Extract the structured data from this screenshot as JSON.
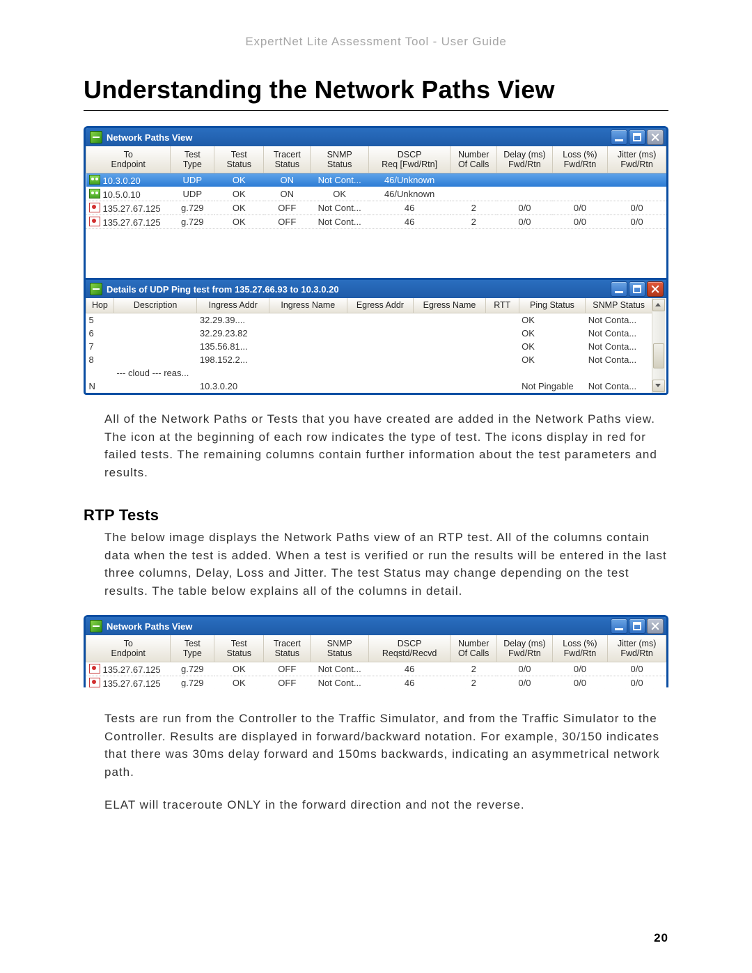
{
  "header": "ExpertNet Lite Assessment Tool - User Guide",
  "title": "Understanding the Network Paths View",
  "page_number": "20",
  "window1": {
    "title": "Network Paths View",
    "columns": {
      "endpoint": "To\nEndpoint",
      "type": "Test\nType",
      "status": "Test\nStatus",
      "tracert": "Tracert\nStatus",
      "snmp": "SNMP\nStatus",
      "dscp": "DSCP\nReq [Fwd/Rtn]",
      "ncalls": "Number\nOf Calls",
      "delay": "Delay (ms)\nFwd/Rtn",
      "loss": "Loss (%)\nFwd/Rtn",
      "jitter": "Jitter (ms)\nFwd/Rtn"
    },
    "rows": [
      {
        "icon": "green",
        "selected": true,
        "endpoint": "10.3.0.20",
        "type": "UDP",
        "status": "OK",
        "tracert": "ON",
        "snmp": "Not Cont...",
        "dscp": "46/Unknown",
        "ncalls": "",
        "delay": "",
        "loss": "",
        "jitter": ""
      },
      {
        "icon": "green",
        "selected": false,
        "endpoint": "10.5.0.10",
        "type": "UDP",
        "status": "OK",
        "tracert": "ON",
        "snmp": "OK",
        "dscp": "46/Unknown",
        "ncalls": "",
        "delay": "",
        "loss": "",
        "jitter": ""
      },
      {
        "icon": "red",
        "selected": false,
        "endpoint": "135.27.67.125",
        "type": "g.729",
        "status": "OK",
        "tracert": "OFF",
        "snmp": "Not Cont...",
        "dscp": "46",
        "ncalls": "2",
        "delay": "0/0",
        "loss": "0/0",
        "jitter": "0/0"
      },
      {
        "icon": "red",
        "selected": false,
        "endpoint": "135.27.67.125",
        "type": "g.729",
        "status": "OK",
        "tracert": "OFF",
        "snmp": "Not Cont...",
        "dscp": "46",
        "ncalls": "2",
        "delay": "0/0",
        "loss": "0/0",
        "jitter": "0/0"
      }
    ]
  },
  "window2": {
    "title": "Details of UDP Ping test from 135.27.66.93 to 10.3.0.20",
    "columns": {
      "hop": "Hop",
      "desc": "Description",
      "inaddr": "Ingress Addr",
      "inname": "Ingress Name",
      "eaddr": "Egress Addr",
      "ename": "Egress Name",
      "rtt": "RTT",
      "ping": "Ping Status",
      "snmp": "SNMP Status"
    },
    "rows": [
      {
        "hop": "5",
        "desc": "",
        "inaddr": "32.29.39....",
        "inname": "",
        "eaddr": "",
        "ename": "",
        "rtt": "",
        "ping": "OK",
        "snmp": "Not Conta..."
      },
      {
        "hop": "6",
        "desc": "",
        "inaddr": "32.29.23.82",
        "inname": "",
        "eaddr": "",
        "ename": "",
        "rtt": "",
        "ping": "OK",
        "snmp": "Not Conta..."
      },
      {
        "hop": "7",
        "desc": "",
        "inaddr": "135.56.81...",
        "inname": "",
        "eaddr": "",
        "ename": "",
        "rtt": "",
        "ping": "OK",
        "snmp": "Not Conta..."
      },
      {
        "hop": "8",
        "desc": "",
        "inaddr": "198.152.2...",
        "inname": "",
        "eaddr": "",
        "ename": "",
        "rtt": "",
        "ping": "OK",
        "snmp": "Not Conta..."
      },
      {
        "hop": "",
        "desc": "--- cloud --- reas...",
        "inaddr": "",
        "inname": "",
        "eaddr": "",
        "ename": "",
        "rtt": "",
        "ping": "",
        "snmp": ""
      },
      {
        "hop": "N",
        "desc": "",
        "inaddr": "10.3.0.20",
        "inname": "",
        "eaddr": "",
        "ename": "",
        "rtt": "",
        "ping": "Not Pingable",
        "snmp": "Not Conta..."
      }
    ]
  },
  "paragraph1": "All of the Network Paths or Tests that you have created are added in the Network Paths view. The icon at the beginning of each row indicates the type of test. The icons display in red for failed tests. The remaining columns contain further information about the test parameters and results.",
  "section1_title": "RTP Tests",
  "paragraph2": "The below image displays the Network Paths view of an RTP test. All of the columns contain data when the test is added. When a test is verified or run the results will be entered in the last three columns, Delay, Loss and Jitter. The test Status may change depending on the test results. The table below explains all of the columns in detail.",
  "window3": {
    "title": "Network Paths View",
    "columns": {
      "endpoint": "To\nEndpoint",
      "type": "Test\nType",
      "status": "Test\nStatus",
      "tracert": "Tracert\nStatus",
      "snmp": "SNMP\nStatus",
      "dscp": "DSCP\nReqstd/Recvd",
      "ncalls": "Number\nOf Calls",
      "delay": "Delay (ms)\nFwd/Rtn",
      "loss": "Loss (%)\nFwd/Rtn",
      "jitter": "Jitter (ms)\nFwd/Rtn"
    },
    "rows": [
      {
        "icon": "red",
        "endpoint": "135.27.67.125",
        "type": "g.729",
        "status": "OK",
        "tracert": "OFF",
        "snmp": "Not Cont...",
        "dscp": "46",
        "ncalls": "2",
        "delay": "0/0",
        "loss": "0/0",
        "jitter": "0/0"
      },
      {
        "icon": "red",
        "endpoint": "135.27.67.125",
        "type": "g.729",
        "status": "OK",
        "tracert": "OFF",
        "snmp": "Not Cont...",
        "dscp": "46",
        "ncalls": "2",
        "delay": "0/0",
        "loss": "0/0",
        "jitter": "0/0"
      }
    ]
  },
  "paragraph3": "Tests are run from the Controller to the Traffic Simulator, and from the Traffic Simulator to the Controller. Results are displayed in forward/backward notation. For example, 30/150 indicates that there was 30ms delay forward and 150ms backwards, indicating an asymmetrical network path.",
  "paragraph4": "ELAT will traceroute ONLY in the forward direction and not the reverse."
}
